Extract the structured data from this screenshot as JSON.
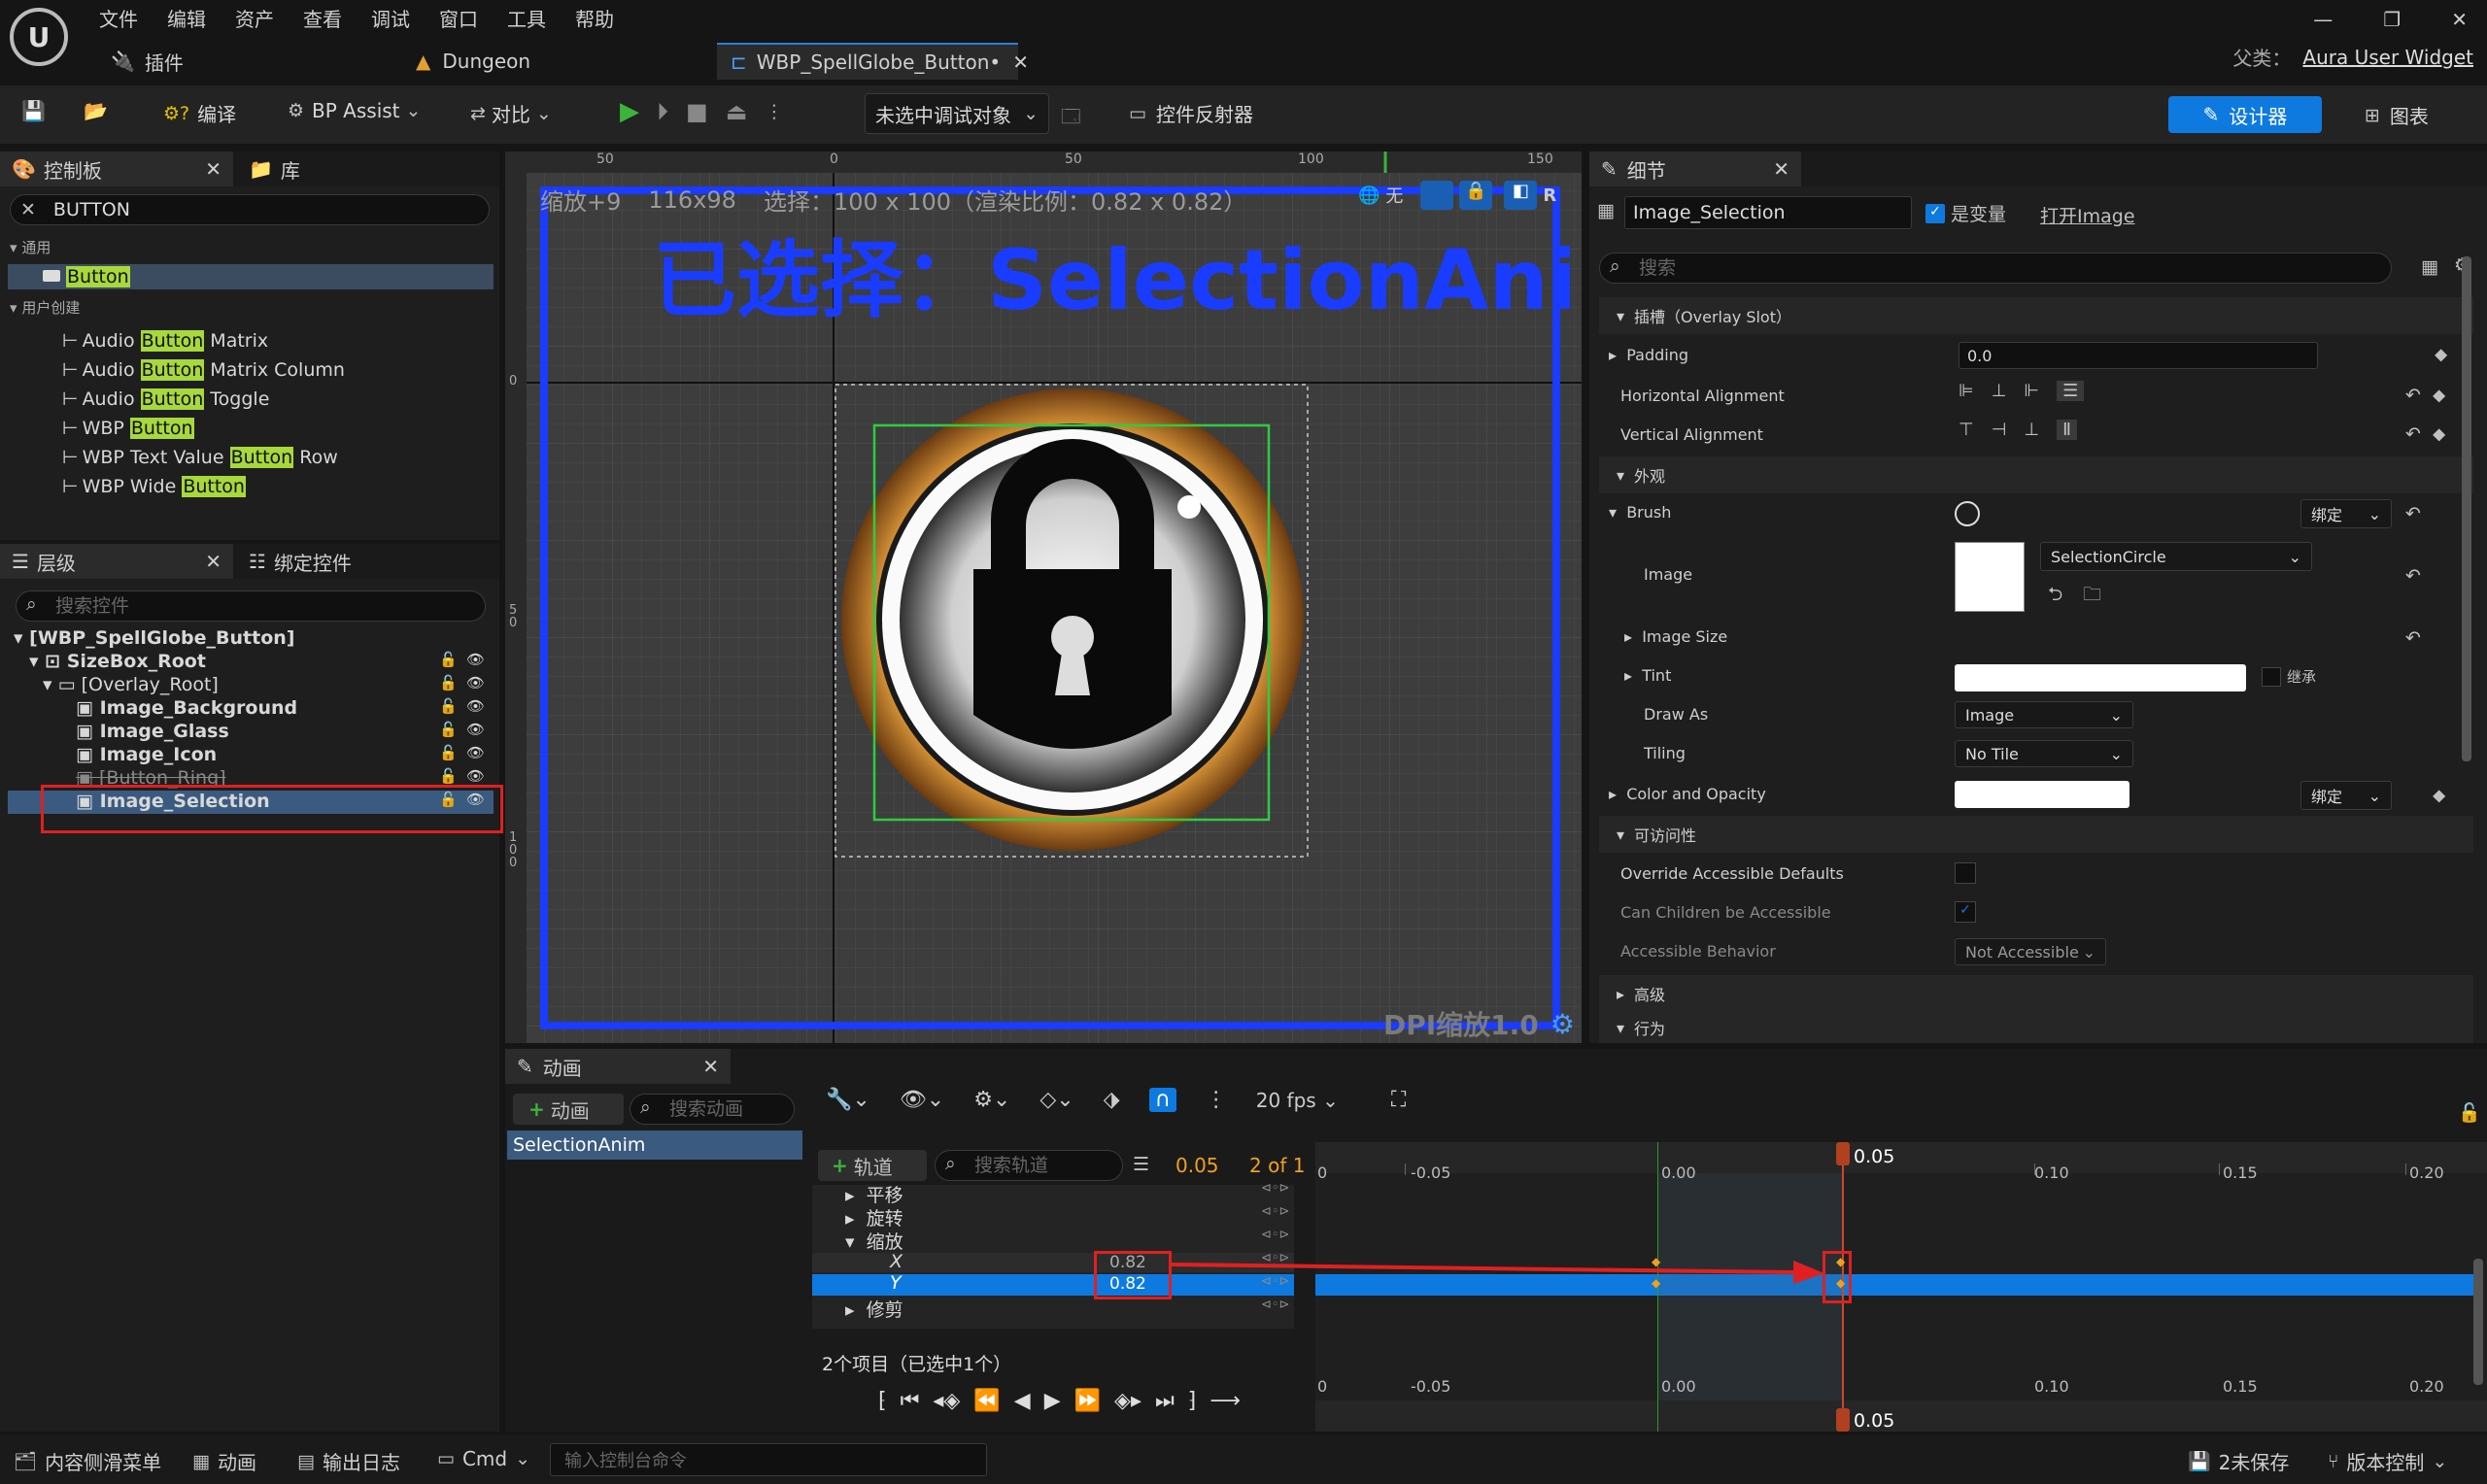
{
  "menu": {
    "items": [
      "文件",
      "编辑",
      "资产",
      "查看",
      "调试",
      "窗口",
      "工具",
      "帮助"
    ]
  },
  "tabs": {
    "plugins": "插件",
    "dungeon": "Dungeon",
    "wbp": "WBP_SpellGlobe_Button•"
  },
  "parent": {
    "label": "父类：",
    "value": "Aura User Widget"
  },
  "toolbar": {
    "compile": "编译",
    "bp_assist": "BP Assist",
    "diff": "对比",
    "debug_target": "未选中调试对象",
    "widget_reflector": "控件反射器",
    "designer": "设计器",
    "graph": "图表"
  },
  "palette": {
    "tab": "控制板",
    "library_tab": "库",
    "search_value": "BUTTON",
    "cat_common": "通用",
    "common_item": "Button",
    "cat_user": "用户创建",
    "items": [
      {
        "pre": "Audio ",
        "hl": "Button",
        "post": " Matrix"
      },
      {
        "pre": "Audio ",
        "hl": "Button",
        "post": " Matrix Column"
      },
      {
        "pre": "Audio ",
        "hl": "Button",
        "post": " Toggle"
      },
      {
        "pre": "WBP ",
        "hl": "Button",
        "post": ""
      },
      {
        "pre": "WBP Text Value ",
        "hl": "Button",
        "post": " Row"
      },
      {
        "pre": "WBP Wide ",
        "hl": "Button",
        "post": ""
      }
    ]
  },
  "hierarchy": {
    "tab": "层级",
    "bind_tab": "绑定控件",
    "search_placeholder": "搜索控件",
    "root": "[WBP_SpellGlobe_Button]",
    "sizebox": "SizeBox_Root",
    "overlay": "[Overlay_Root]",
    "children": [
      "Image_Background",
      "Image_Glass",
      "Image_Icon",
      "[Button_Ring]",
      "Image_Selection"
    ]
  },
  "canvas": {
    "zoom": "缩放+9",
    "size": "116x98",
    "selected_info": "选择：100 x 100（渲染比例：0.82 x 0.82）",
    "none_label": "无",
    "r_label": "R",
    "big_title": "已选择：SelectionAnim",
    "dpi": "DPI缩放1.0",
    "ruler_top": [
      "50",
      "0",
      "50",
      "100",
      "150"
    ],
    "ruler_left": [
      "0",
      "5\n0",
      "1\n0\n0"
    ]
  },
  "details": {
    "tab": "细节",
    "name": "Image_Selection",
    "is_variable": "是变量",
    "open_image": "打开Image",
    "search_placeholder": "搜索",
    "slot_section": "插槽（Overlay Slot）",
    "padding_label": "Padding",
    "padding_value": "0.0",
    "halign_label": "Horizontal Alignment",
    "valign_label": "Vertical Alignment",
    "appearance_section": "外观",
    "brush_label": "Brush",
    "bind_label": "绑定",
    "image_label": "Image",
    "image_asset": "SelectionCircle",
    "image_size_label": "Image Size",
    "tint_label": "Tint",
    "inherit_label": "继承",
    "draw_as_label": "Draw As",
    "draw_as_value": "Image",
    "tiling_label": "Tiling",
    "tiling_value": "No Tile",
    "color_opacity_label": "Color and Opacity",
    "access_section": "可访问性",
    "override_label": "Override Accessible Defaults",
    "children_access_label": "Can Children be Accessible",
    "access_behavior_label": "Accessible Behavior",
    "access_behavior_value": "Not Accessible",
    "advanced_section": "高级",
    "behavior_section": "行为"
  },
  "animation": {
    "tab": "动画",
    "add_anim": "动画",
    "search_anim": "搜索动画",
    "anim_item": "SelectionAnim",
    "fps": "20 fps",
    "add_track": "轨道",
    "search_track": "搜索轨道",
    "time_value": "0.05",
    "frame_of": "2 of 1",
    "tracks": [
      "平移",
      "旋转",
      "缩放",
      "X",
      "Y",
      "修剪"
    ],
    "x_value": "0.82",
    "y_value": "0.82",
    "items_count": "2个项目（已选中1个）",
    "ticks": [
      "0",
      "-0.05",
      "0.00",
      "0.10",
      "0.15",
      "0.20"
    ],
    "playhead_time": "0.05"
  },
  "statusbar": {
    "content_drawer": "内容侧滑菜单",
    "anim": "动画",
    "output_log": "输出日志",
    "cmd": "Cmd",
    "console_placeholder": "输入控制台命令",
    "unsaved": "2未保存",
    "source_control": "版本控制"
  },
  "colors": {
    "accent": "#0e7ae0",
    "highlight": "#a7d83c",
    "selection_blue": "#2a7fd6",
    "annotation_red": "#e02020"
  }
}
